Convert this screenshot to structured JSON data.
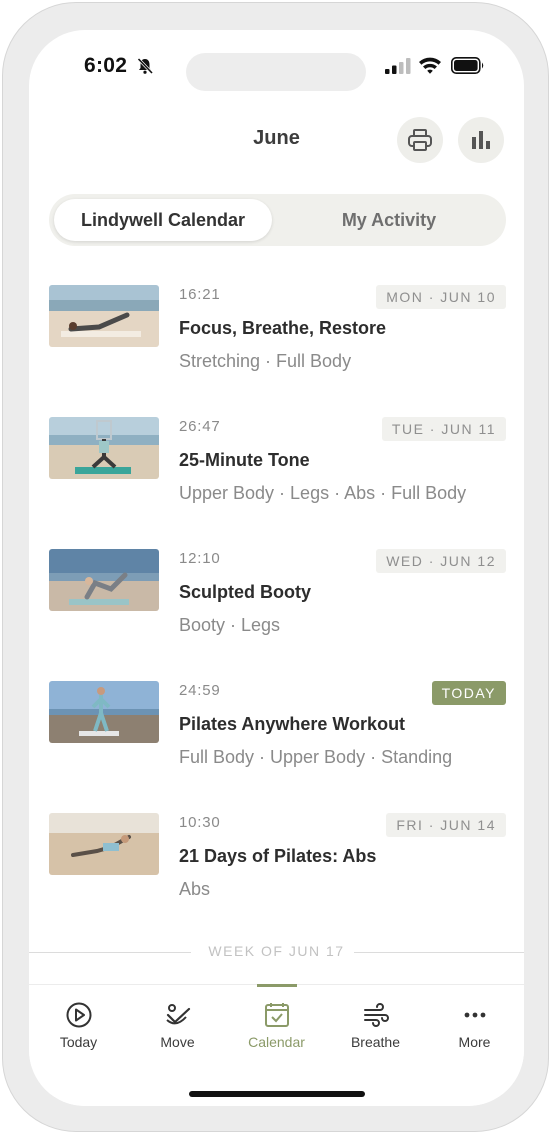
{
  "status": {
    "time": "6:02"
  },
  "header": {
    "title": "June"
  },
  "segmented": {
    "active": "Lindywell Calendar",
    "inactive": "My Activity"
  },
  "workouts": [
    {
      "duration": "16:21",
      "date": "MON · JUN 10",
      "name": "Focus, Breathe, Restore",
      "tags": "Stretching · Full Body"
    },
    {
      "duration": "26:47",
      "date": "TUE · JUN 11",
      "name": "25-Minute Tone",
      "tags": "Upper Body · Legs · Abs · Full Body"
    },
    {
      "duration": "12:10",
      "date": "WED · JUN 12",
      "name": "Sculpted Booty",
      "tags": "Booty · Legs"
    },
    {
      "duration": "24:59",
      "date": "TODAY",
      "name": "Pilates Anywhere Workout",
      "tags": "Full Body · Upper Body · Standing"
    },
    {
      "duration": "10:30",
      "date": "FRI · JUN 14",
      "name": "21 Days of Pilates: Abs",
      "tags": "Abs"
    }
  ],
  "week_divider": "WEEK OF JUN 17",
  "tabs": [
    {
      "label": "Today",
      "icon": "play-circle-icon"
    },
    {
      "label": "Move",
      "icon": "move-icon"
    },
    {
      "label": "Calendar",
      "icon": "calendar-check-icon",
      "active": true
    },
    {
      "label": "Breathe",
      "icon": "wind-icon"
    },
    {
      "label": "More",
      "icon": "more-dots-icon"
    }
  ],
  "colors": {
    "accent": "#8b9a68",
    "badge_bg": "#f1f1ee",
    "text_dark": "#2d2d2d",
    "text_muted": "#8a8a8a"
  }
}
